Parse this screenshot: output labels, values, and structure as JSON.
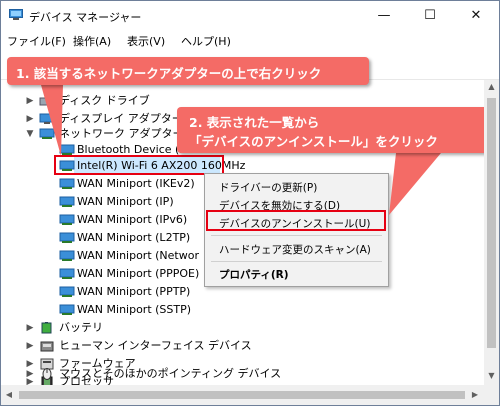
{
  "window": {
    "title": "デバイス マネージャー",
    "minimize_glyph": "—",
    "maximize_glyph": "☐",
    "close_glyph": "✕"
  },
  "menubar": [
    "ファイル(F)",
    "操作(A)",
    "表示(V)",
    "ヘルプ(H)"
  ],
  "toolbar": [
    "back-icon",
    "forward-icon",
    "properties-icon",
    "help-icon",
    "scan-hardware-icon",
    "monitor-icon"
  ],
  "tree": {
    "partial_top": "ディスク ドライブ",
    "display_adapters": "ディスプレイ アダプター",
    "network_adapters": "ネットワーク アダプター",
    "network_children": [
      "Bluetooth Device (Per",
      "Intel(R) Wi-Fi 6 AX200 160MHz",
      "WAN Miniport (IKEv2)",
      "WAN Miniport (IP)",
      "WAN Miniport (IPv6)",
      "WAN Miniport (L2TP)",
      "WAN Miniport (Networ",
      "WAN Miniport (PPPOE)",
      "WAN Miniport (PPTP)",
      "WAN Miniport (SSTP)"
    ],
    "after": [
      "バッテリ",
      "ヒューマン インターフェイス デバイス",
      "ファームウェア",
      "プロセッサ",
      "マウスとそのほかのポインティング デバイス"
    ]
  },
  "context_menu": {
    "update_driver": "ドライバーの更新(P)",
    "disable_device": "デバイスを無効にする(D)",
    "uninstall_device": "デバイスのアンインストール(U)",
    "scan_hardware": "ハードウェア変更のスキャン(A)",
    "properties": "プロパティ(R)"
  },
  "callouts": {
    "step1": "1. 該当するネットワークアダプターの上で右クリック",
    "step2_line1": "2. 表示された一覧から",
    "step2_line2": "「デバイスのアンインストール」をクリック"
  },
  "colors": {
    "callout": "#f46b66",
    "highlight": "#e60012",
    "selection": "#cce8ff"
  }
}
